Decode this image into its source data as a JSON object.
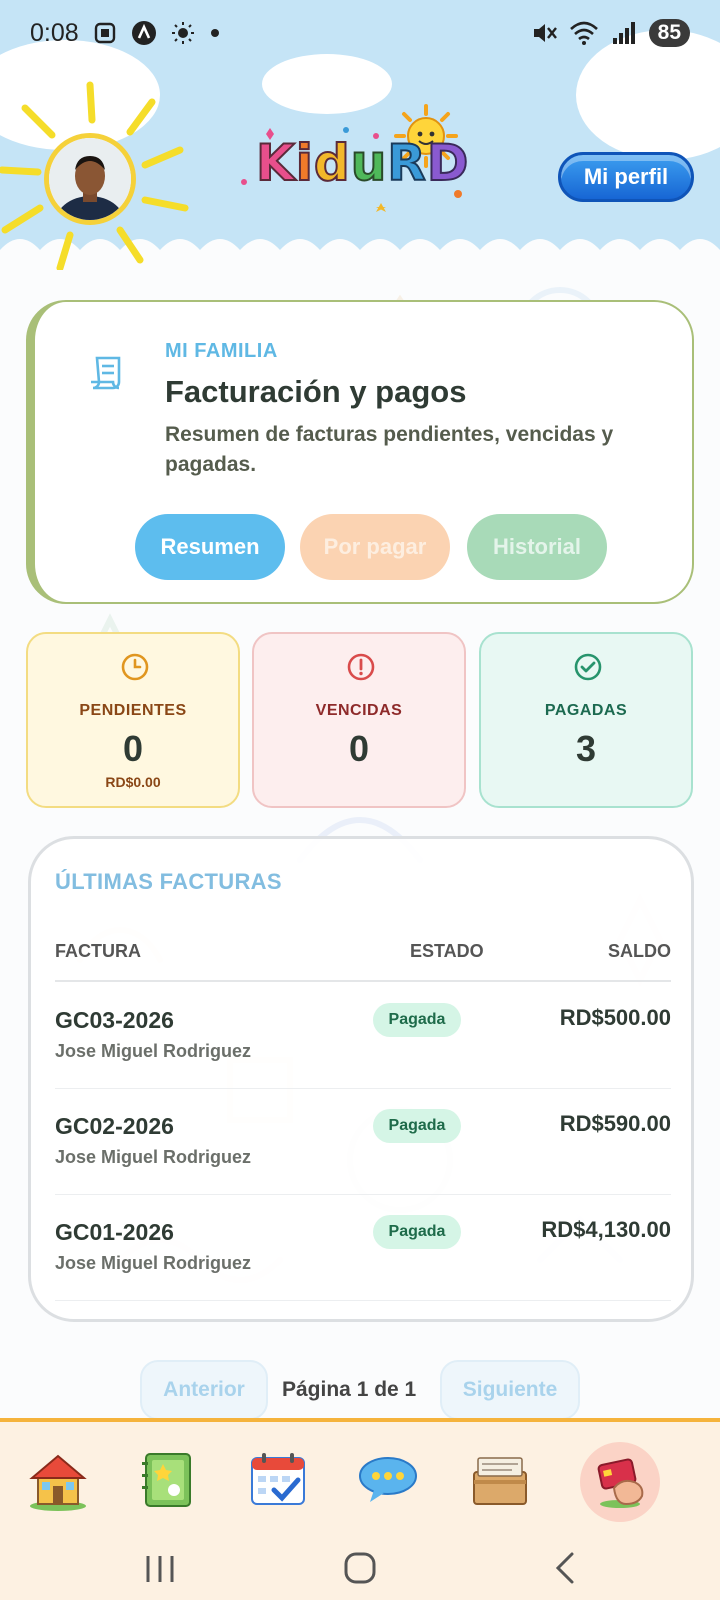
{
  "status_bar": {
    "time": "0:08",
    "battery": "85"
  },
  "header": {
    "logo_text": "KiduRD",
    "profile_button": "Mi perfil"
  },
  "hero": {
    "eyebrow": "MI FAMILIA",
    "title": "Facturación y pagos",
    "description": "Resumen de facturas pendientes, vencidas y pagadas.",
    "tabs": [
      {
        "label": "Resumen",
        "active": true
      },
      {
        "label": "Por pagar",
        "active": false
      },
      {
        "label": "Historial",
        "active": false
      }
    ]
  },
  "stats": {
    "pending": {
      "label": "PENDIENTES",
      "value": "0",
      "amount": "RD$0.00",
      "icon": "clock-icon",
      "color": "#e0961f"
    },
    "overdue": {
      "label": "VENCIDAS",
      "value": "0",
      "icon": "alert-circle-icon",
      "color": "#d94b4b"
    },
    "paid": {
      "label": "PAGADAS",
      "value": "3",
      "icon": "check-circle-icon",
      "color": "#27946c"
    }
  },
  "invoices": {
    "title": "ÚLTIMAS FACTURAS",
    "columns": {
      "invoice": "FACTURA",
      "status": "ESTADO",
      "balance": "SALDO"
    },
    "rows": [
      {
        "number": "GC03-2026",
        "name": "Jose Miguel Rodriguez",
        "status": "Pagada",
        "amount": "RD$500.00"
      },
      {
        "number": "GC02-2026",
        "name": "Jose Miguel Rodriguez",
        "status": "Pagada",
        "amount": "RD$590.00"
      },
      {
        "number": "GC01-2026",
        "name": "Jose Miguel Rodriguez",
        "status": "Pagada",
        "amount": "RD$4,130.00"
      }
    ]
  },
  "pagination": {
    "prev": "Anterior",
    "info": "Página 1 de 1",
    "next": "Siguiente"
  },
  "bottom_nav": {
    "items": [
      "home-icon",
      "notebook-icon",
      "calendar-icon",
      "chat-icon",
      "documents-icon",
      "payments-icon"
    ],
    "active": "payments-icon"
  },
  "system_nav": [
    "recent-apps-icon",
    "home-circle-icon",
    "back-icon"
  ]
}
